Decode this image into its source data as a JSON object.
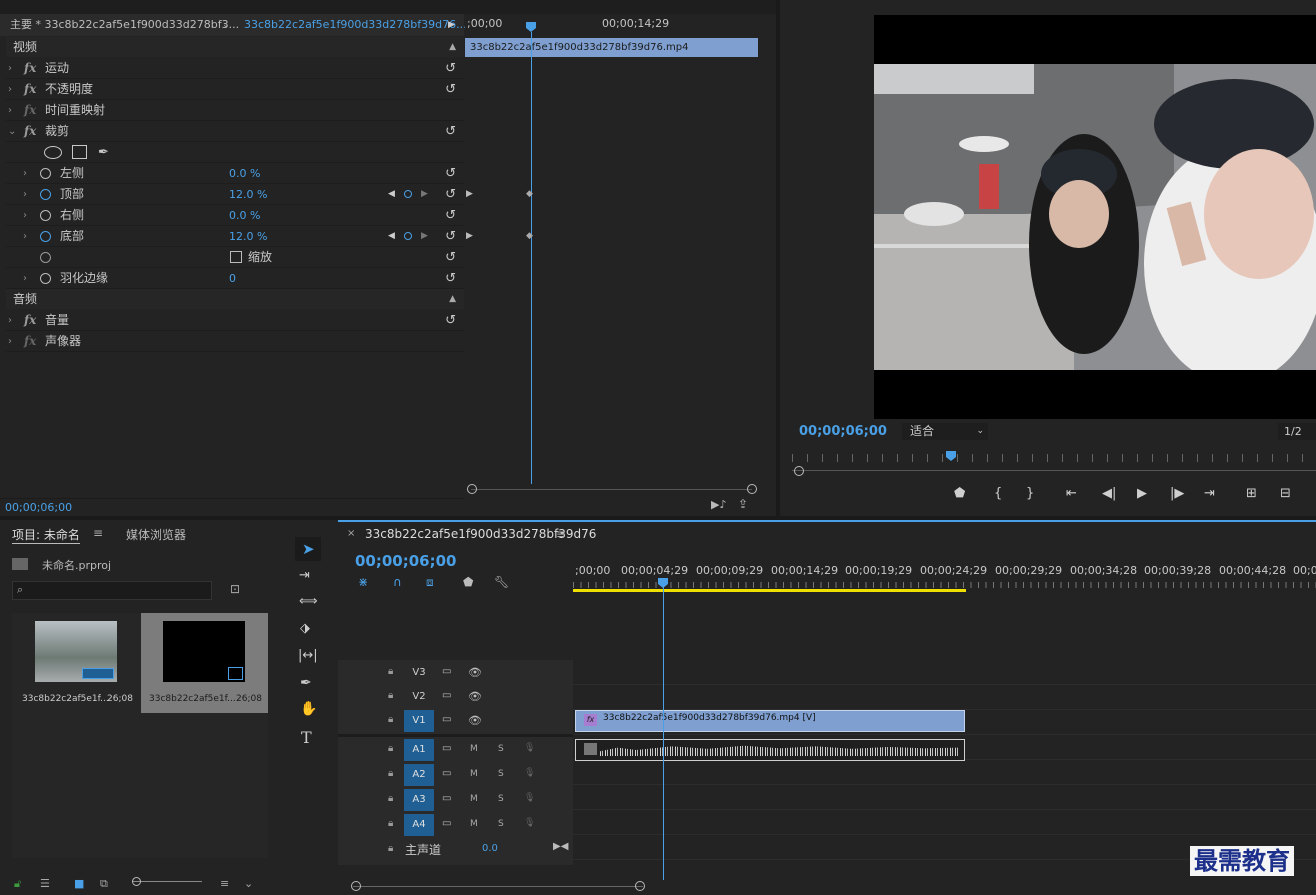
{
  "effect_controls": {
    "tab_master": "主要 * 33c8b22c2af5e1f900d33d278bf3...",
    "tab_clip": "33c8b22c2af5e1f900d33d278bf39d76...",
    "ruler_start": ";00;00",
    "ruler_mid": "00;00;14;29",
    "clip_label": "33c8b22c2af5e1f900d33d278bf39d76.mp4",
    "section_video": "视频",
    "motion": "运动",
    "opacity": "不透明度",
    "time_remap": "时间重映射",
    "crop": "裁剪",
    "left": "左侧",
    "left_val": "0.0 %",
    "top": "顶部",
    "top_val": "12.0 %",
    "right": "右侧",
    "right_val": "0.0 %",
    "bottom": "底部",
    "bottom_val": "12.0 %",
    "zoom": "缩放",
    "feather": "羽化边缘",
    "feather_val": "0",
    "section_audio": "音频",
    "volume": "音量",
    "panner": "声像器",
    "timecode": "00;00;06;00"
  },
  "program": {
    "timecode": "00;00;06;00",
    "fit": "适合",
    "resolution": "1/2"
  },
  "project": {
    "tab_project": "项目: 未命名",
    "tab_media": "媒体浏览器",
    "file": "未命名.prproj",
    "items": [
      {
        "name": "33c8b22c2af5e1f...",
        "dur": "26;08"
      },
      {
        "name": "33c8b22c2af5e1f...",
        "dur": "26;08"
      }
    ]
  },
  "timeline": {
    "seq_name": "33c8b22c2af5e1f900d33d278bf39d76",
    "timecode": "00;00;06;00",
    "ruler": [
      ";00;00",
      "00;00;04;29",
      "00;00;09;29",
      "00;00;14;29",
      "00;00;19;29",
      "00;00;24;29",
      "00;00;29;29",
      "00;00;34;28",
      "00;00;39;28",
      "00;00;44;28",
      "00;0"
    ],
    "video_tracks": [
      "V3",
      "V2",
      "V1"
    ],
    "audio_tracks": [
      "A1",
      "A2",
      "A3",
      "A4"
    ],
    "mute": "M",
    "solo": "S",
    "master": "主声道",
    "master_val": "0.0",
    "clip_v": "33c8b22c2af5e1f900d33d278bf39d76.mp4 [V]"
  },
  "watermark": "最需教育",
  "colors": {
    "accent": "#4aa0e6",
    "clip": "#7e9fd0",
    "selected_track": "#1f5f94",
    "workarea": "#f0e000"
  }
}
